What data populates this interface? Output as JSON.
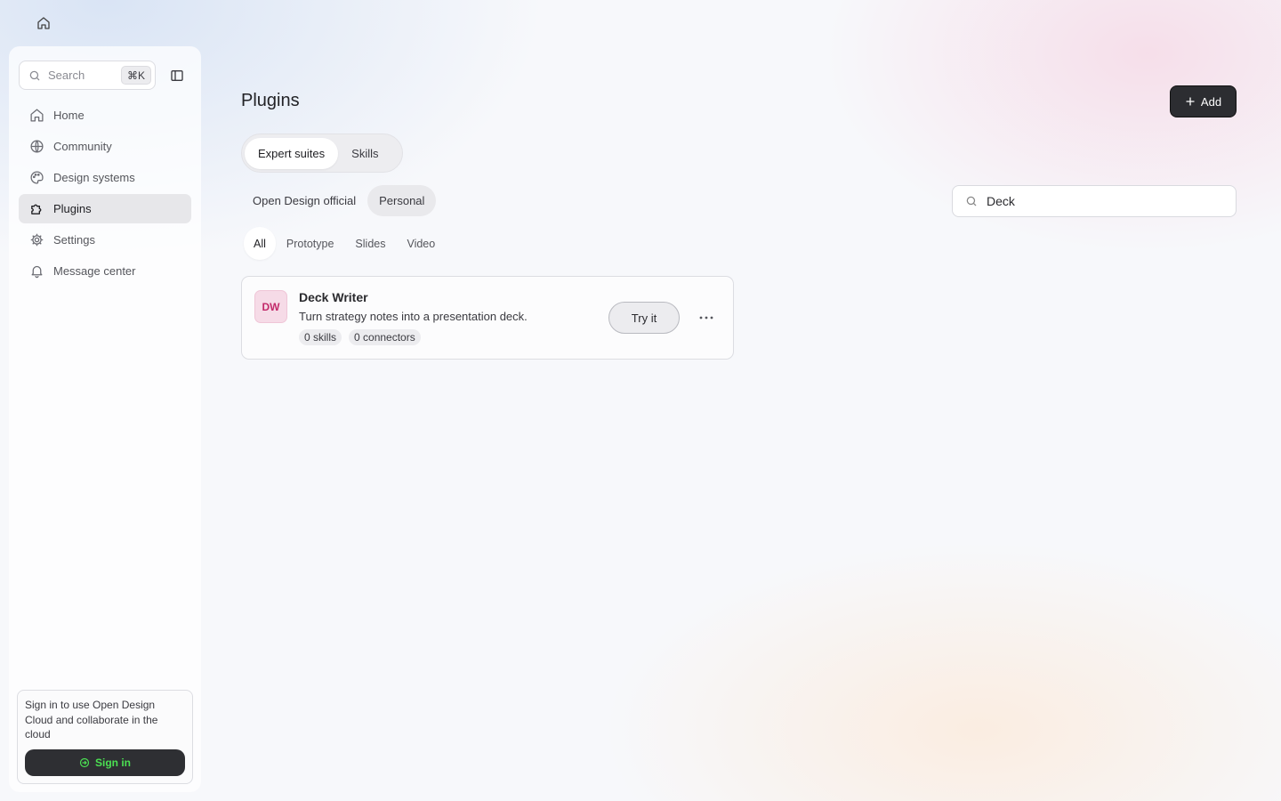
{
  "sidebar": {
    "search": {
      "label": "Search",
      "shortcut": "⌘K"
    },
    "items": [
      {
        "label": "Home",
        "icon": "home-icon"
      },
      {
        "label": "Community",
        "icon": "globe-icon"
      },
      {
        "label": "Design systems",
        "icon": "palette-icon"
      },
      {
        "label": "Plugins",
        "icon": "puzzle-icon",
        "active": true
      },
      {
        "label": "Settings",
        "icon": "gear-icon"
      },
      {
        "label": "Message center",
        "icon": "bell-icon"
      }
    ],
    "signin": {
      "message": "Sign in to use Open Design Cloud and collaborate in the cloud",
      "button": "Sign in"
    }
  },
  "main": {
    "title": "Plugins",
    "add_button": "Add",
    "segment_tabs": [
      {
        "label": "Expert suites",
        "active": true
      },
      {
        "label": "Skills",
        "active": false
      }
    ],
    "source_tabs": [
      {
        "label": "Open Design official",
        "active": false
      },
      {
        "label": "Personal",
        "active": true
      }
    ],
    "filter": {
      "value": "Deck"
    },
    "category_tabs": [
      {
        "label": "All",
        "active": true
      },
      {
        "label": "Prototype",
        "active": false
      },
      {
        "label": "Slides",
        "active": false
      },
      {
        "label": "Video",
        "active": false
      }
    ],
    "plugins": [
      {
        "initials": "DW",
        "name": "Deck Writer",
        "description": "Turn strategy notes into a presentation deck.",
        "skills": "0 skills",
        "connectors": "0 connectors",
        "try_label": "Try it"
      }
    ]
  },
  "colors": {
    "accent_dark": "#2c2d31",
    "signin_text": "#4be052",
    "avatar_bg": "#f6dbe7",
    "avatar_text": "#c22a6a"
  }
}
